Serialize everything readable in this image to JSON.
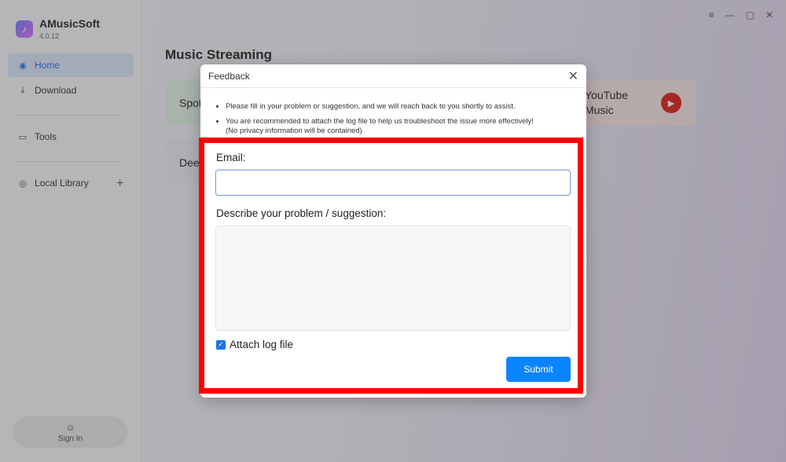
{
  "app": {
    "name": "AMusicSoft",
    "version": "4.0.12"
  },
  "sidebar": {
    "items": [
      {
        "label": "Home"
      },
      {
        "label": "Download"
      },
      {
        "label": "Tools"
      },
      {
        "label": "Local Library"
      }
    ],
    "signin": "Sign In"
  },
  "main": {
    "title": "Music Streaming",
    "cards": [
      {
        "label": "Spot"
      },
      {
        "label": "Dee"
      },
      {
        "label": "YouTube\nMusic"
      }
    ]
  },
  "dialog": {
    "title": "Feedback",
    "notes": [
      "Please fill in your problem or suggestion, and we will reach back to you shortly to assist.",
      "You are recommended to attach the log file to help us troubleshoot the issue more effectively!",
      "(No privacy information will be contained)"
    ],
    "email_label": "Email:",
    "email_value": "",
    "desc_label": "Describe your problem / suggestion:",
    "desc_value": "",
    "attach_label": "Attach log file",
    "attach_checked": true,
    "submit_label": "Submit"
  },
  "colors": {
    "accent": "#0a84ff",
    "highlight": "#ff0000",
    "youtube": "#e01919"
  }
}
